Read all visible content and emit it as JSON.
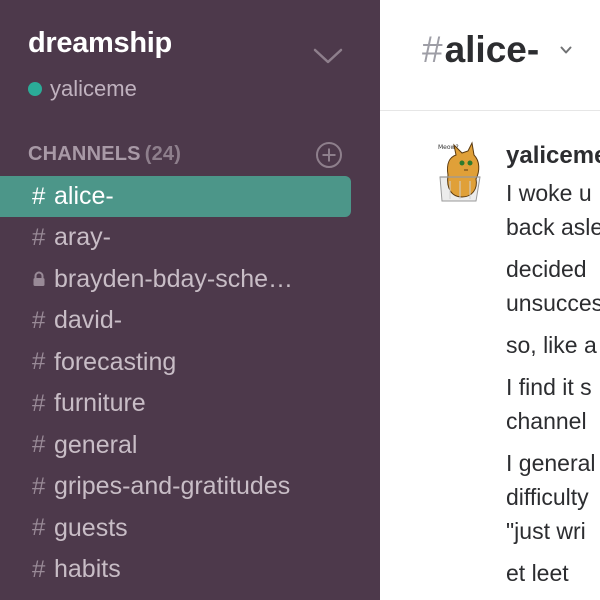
{
  "team": {
    "name": "dreamship",
    "user": "yaliceme",
    "presence_color": "#2bac98"
  },
  "channels": {
    "header": "CHANNELS",
    "count": "(24)",
    "items": [
      {
        "label": "alice-",
        "prefix": "#",
        "active": true
      },
      {
        "label": "aray-",
        "prefix": "#"
      },
      {
        "label": "brayden-bday-sche…",
        "prefix": "lock-icon"
      },
      {
        "label": "david-",
        "prefix": "#"
      },
      {
        "label": "forecasting",
        "prefix": "#"
      },
      {
        "label": "furniture",
        "prefix": "#"
      },
      {
        "label": "general",
        "prefix": "#"
      },
      {
        "label": "gripes-and-gratitudes",
        "prefix": "#"
      },
      {
        "label": "guests",
        "prefix": "#"
      },
      {
        "label": "habits",
        "prefix": "#"
      }
    ]
  },
  "header": {
    "hash": "#",
    "title": "alice-"
  },
  "message": {
    "author": "yaliceme",
    "avatar_caption": "Meow?",
    "paragraphs": [
      [
        "I woke u",
        "back asle"
      ],
      [
        "decided ",
        "unsucces"
      ],
      [
        "so, like a"
      ],
      [
        "I find it s",
        "channel "
      ],
      [
        "I general",
        "difficulty",
        "\"just wri"
      ],
      [
        "et leet"
      ]
    ]
  },
  "colors": {
    "sidebar_bg": "#4d394b",
    "active_channel_bg": "#4c9689",
    "main_bg": "#ffffff"
  }
}
